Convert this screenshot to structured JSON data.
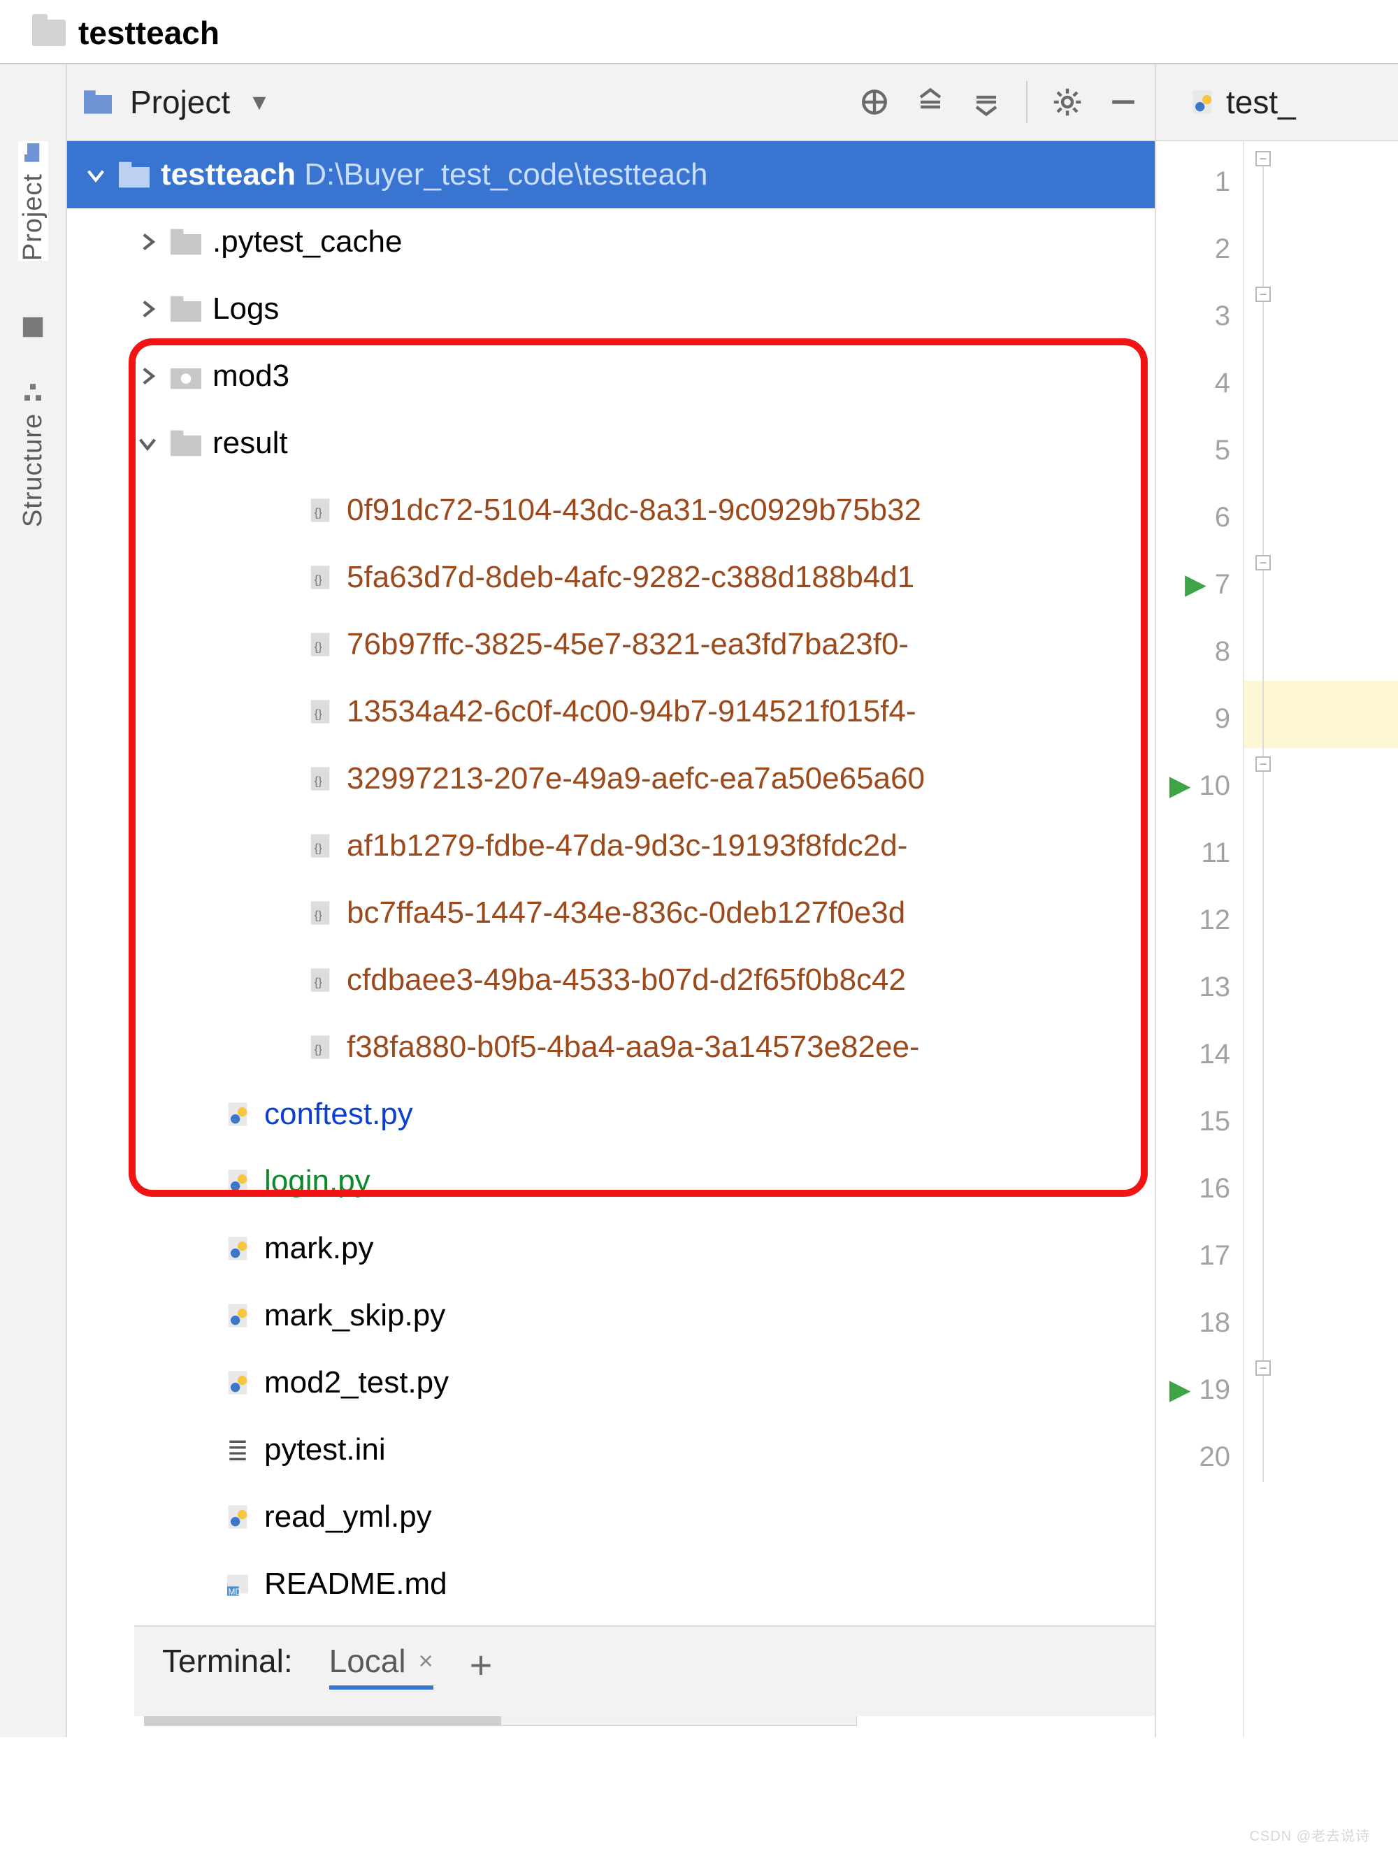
{
  "breadcrumb": {
    "name": "testteach"
  },
  "panel": {
    "title": "Project"
  },
  "tree": {
    "root": {
      "name": "testteach",
      "path": "D:\\Buyer_test_code\\testteach"
    },
    "folders": {
      "pytest_cache": ".pytest_cache",
      "logs": "Logs",
      "mod3": "mod3",
      "result": "result"
    },
    "result_files": [
      "0f91dc72-5104-43dc-8a31-9c0929b75b32",
      "5fa63d7d-8deb-4afc-9282-c388d188b4d1",
      "76b97ffc-3825-45e7-8321-ea3fd7ba23f0-",
      "13534a42-6c0f-4c00-94b7-914521f015f4-",
      "32997213-207e-49a9-aefc-ea7a50e65a60",
      "af1b1279-fdbe-47da-9d3c-19193f8fdc2d-",
      "bc7ffa45-1447-434e-836c-0deb127f0e3d",
      "cfdbaee3-49ba-4533-b07d-d2f65f0b8c42",
      "f38fa880-b0f5-4ba4-aa9a-3a14573e82ee-"
    ],
    "files": {
      "conftest": "conftest.py",
      "login": "login.py",
      "mark": "mark.py",
      "mark_skip": "mark_skip.py",
      "mod2_test": "mod2_test.py",
      "pytest_ini": "pytest.ini",
      "read_yml": "read_yml.py",
      "readme": "README.md"
    }
  },
  "side_tabs": {
    "project": "Project",
    "structure": "Structure"
  },
  "editor": {
    "tab": "test_",
    "lines": [
      "1",
      "2",
      "3",
      "4",
      "5",
      "6",
      "7",
      "8",
      "9",
      "10",
      "11",
      "12",
      "13",
      "14",
      "15",
      "16",
      "17",
      "18",
      "19",
      "20"
    ],
    "runnable_lines": [
      7,
      10,
      19
    ],
    "highlight_line": 9
  },
  "terminal": {
    "label": "Terminal:",
    "tab": "Local"
  },
  "watermark": "CSDN @老去说诗"
}
